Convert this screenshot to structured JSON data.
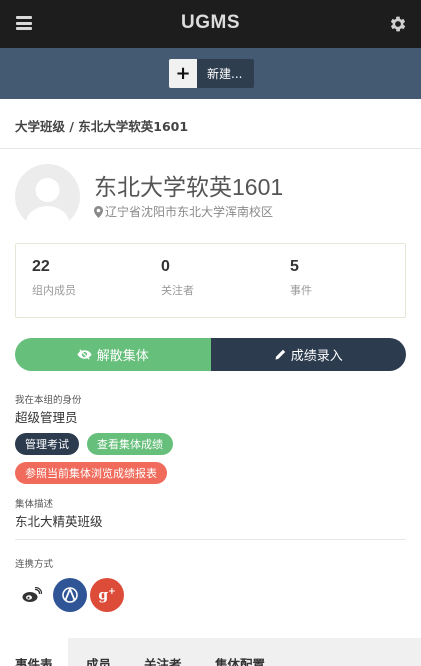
{
  "topbar": {
    "brand": "UGMS",
    "menu_icon": "hamburger-icon",
    "settings_icon": "gear-icon"
  },
  "actionbar": {
    "new_button_label": "新建..."
  },
  "breadcrumb": "大学班级 / 东北大学软英1601",
  "group": {
    "name": "东北大学软英1601",
    "location": "辽宁省沈阳市东北大学浑南校区"
  },
  "stats": [
    {
      "value": "22",
      "label": "组内成员"
    },
    {
      "value": "0",
      "label": "关注者"
    },
    {
      "value": "5",
      "label": "事件"
    }
  ],
  "actions": {
    "dissolve": "解散集体",
    "score_entry": "成绩录入"
  },
  "identity": {
    "label": "我在本组的身份",
    "value": "超级管理员"
  },
  "pills": {
    "manage_exams": "管理考试",
    "view_scores": "查看集体成绩",
    "report": "参照当前集体浏览成绩报表"
  },
  "description": {
    "label": "集体描述",
    "value": "东北大精英班级"
  },
  "contact": {
    "label": "连携方式"
  },
  "tabs": [
    "事件表",
    "成员",
    "关注者",
    "集体配置"
  ],
  "colors": {
    "topbar": "#1d1d1d",
    "actionbar": "#435a72",
    "green": "#66bf7a",
    "navy": "#2c3b4e",
    "red": "#f06b5b",
    "weibo_blue": "#2f5597",
    "google_red": "#dd4b39"
  }
}
